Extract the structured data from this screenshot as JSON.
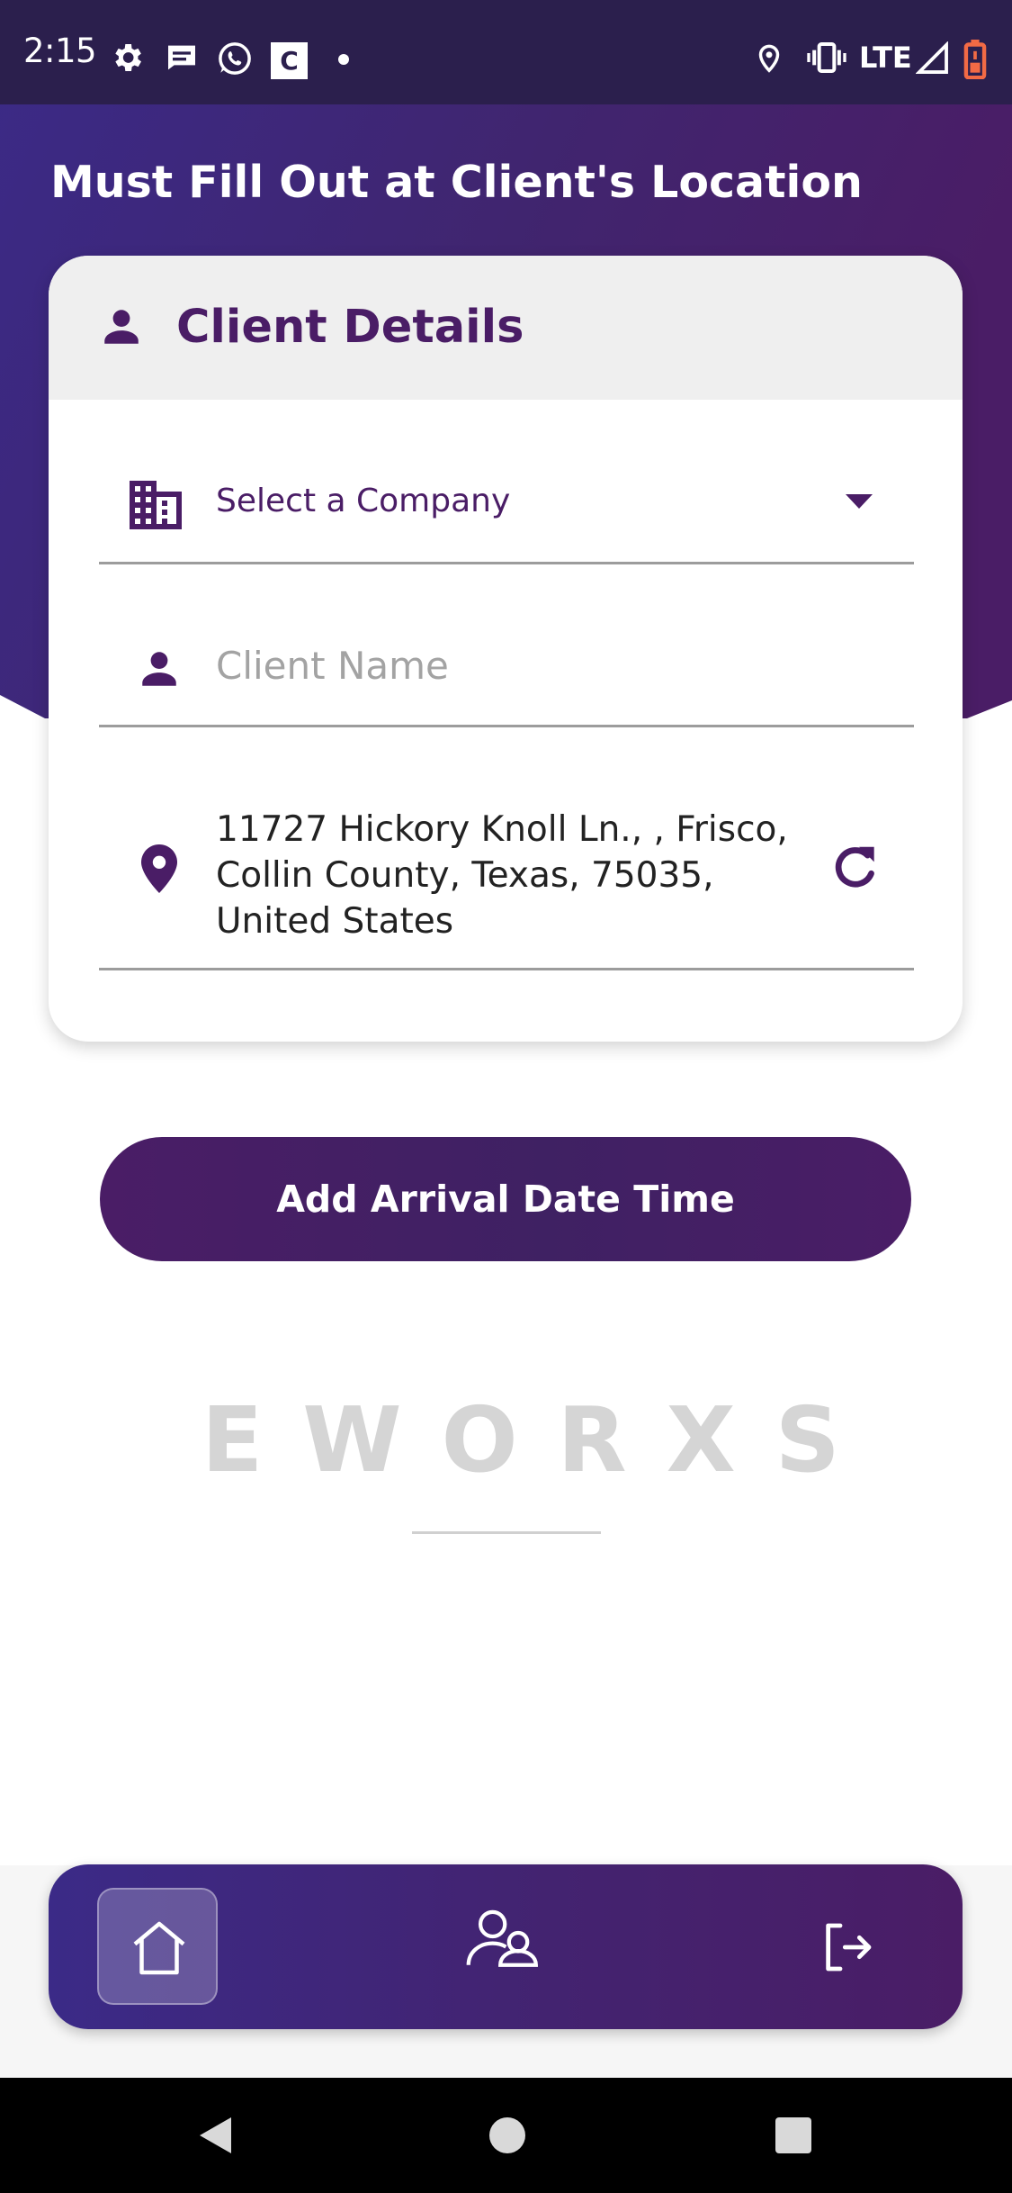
{
  "status_bar": {
    "time": "2:15",
    "c_label": "C",
    "network": "LTE",
    "icons": [
      "gear-icon",
      "message-icon",
      "whatsapp-icon",
      "c-app-icon",
      "dot-icon",
      "location-icon",
      "vibrate-icon",
      "signal-icon",
      "battery-icon"
    ]
  },
  "page": {
    "heading": "Must Fill Out at Client's Location"
  },
  "client_details": {
    "title": "Client Details",
    "company_select": {
      "placeholder": "Select a Company",
      "icon": "building-icon"
    },
    "client_name": {
      "placeholder": "Client Name",
      "value": "",
      "icon": "person-icon"
    },
    "address": {
      "value": "11727 Hickory Knoll Ln., , Frisco, Collin County, Texas, 75035, United States",
      "icon": "location-pin-icon",
      "action_icon": "refresh-icon"
    }
  },
  "actions": {
    "arrival_button_label": "Add Arrival Date Time"
  },
  "brand": {
    "logo_text": "EWORXS"
  },
  "bottom_nav": {
    "items": [
      {
        "name": "home",
        "icon": "home-icon",
        "active": true
      },
      {
        "name": "profile",
        "icon": "users-icon",
        "active": false
      },
      {
        "name": "logout",
        "icon": "logout-icon",
        "active": false
      }
    ]
  },
  "system_nav": {
    "items": [
      "back-icon",
      "home-circle-icon",
      "recents-icon"
    ]
  },
  "colors": {
    "primary": "#4a1d66",
    "hero_gradient_start": "#3b2a87",
    "hero_gradient_end": "#4a1d66",
    "status_bar": "#2b1f4d",
    "card_header": "#efefef",
    "placeholder": "#a3a3a3",
    "battery": "#f26a45"
  }
}
